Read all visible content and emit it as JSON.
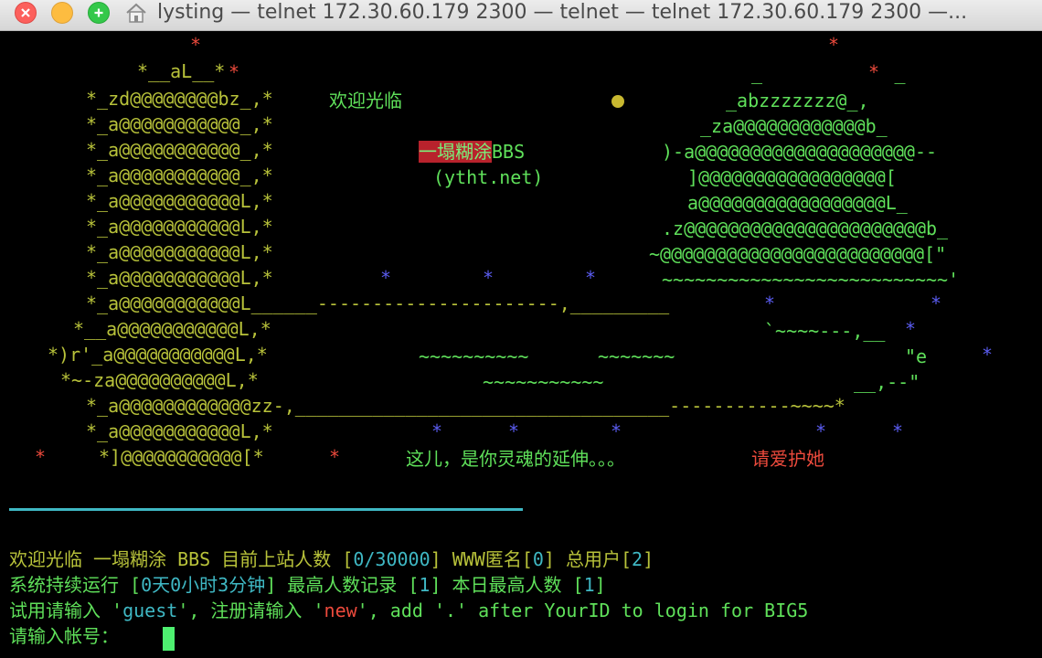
{
  "window": {
    "title": "lysting — telnet 172.30.60.179 2300 — telnet — telnet 172.30.60.179 2300 —..."
  },
  "art": {
    "welcome": "欢迎光临",
    "bbs_highlight": "一塌糊涂",
    "bbs_suffix": "BBS",
    "bbs_domain": "(ytht.net)",
    "slogan": "这儿，是你灵魂的延伸。。。",
    "slogan_red": "请爱护她",
    "left_lines": [
      "*__aL__*",
      "*_zd@@@@@@@@bz_,*",
      "*_a@@@@@@@@@@@_,*",
      "*_a@@@@@@@@@@@_,*",
      "*_a@@@@@@@@@@@_,*",
      "*_a@@@@@@@@@@@L,*",
      "*_a@@@@@@@@@@@L,*",
      "*_a@@@@@@@@@@@L,*",
      "*_a@@@@@@@@@@@L,*",
      "*_a@@@@@@@@@@@L______----------------------,_________",
      "*__a@@@@@@@@@@@L,*",
      "*)r'_a@@@@@@@@@@@L,*",
      "*~-za@@@@@@@@@@L,*",
      "*_a@@@@@@@@@@@@zz-,__________________________________-----------~~~~*",
      "*_a@@@@@@@@@@@L,*",
      "*]@@@@@@@@@@@[*"
    ],
    "right_lines": [
      "_            _",
      "_abzzzzzzz@_,",
      "_za@@@@@@@@@@@@b_",
      ")-a@@@@@@@@@@@@@@@@@@@@--",
      "]@@@@@@@@@@@@@@@@@[",
      "a@@@@@@@@@@@@@@@@@L_",
      ".z@@@@@@@@@@@@@@@@@@@@@@b_",
      "~@@@@@@@@@@@@@@@@@@@@@@@@[\"",
      "~~~~~~~~~~~~~~~~~~~~~~~~~~'",
      "`~~~~---,__",
      "\"e",
      "__,--\""
    ],
    "waves": [
      "~~~~~~~~~~",
      "~~~~~~~",
      "~~~~~~~~~~~"
    ]
  },
  "status": {
    "line1": {
      "prefix": "欢迎光临 一塌糊涂 BBS 目前上站人数 [",
      "online": "0/30000",
      "mid": "] WWW匿名[",
      "anon": "0",
      "mid2": "] 总用户[",
      "users": "2",
      "end": "]"
    },
    "line2": {
      "prefix": "系统持续运行 [",
      "uptime": "0天0小时3分钟",
      "mid": "] 最高人数记录 [",
      "record": "1",
      "mid2": "] 本日最高人数 [",
      "today": "1",
      "end": "]"
    },
    "line3": {
      "a": "试用请输入 '",
      "guest": "guest",
      "b": "', 注册请输入 '",
      "new": "new",
      "c": "', add '.' after YourID to login for BIG5"
    },
    "prompt": "请输入帐号："
  }
}
